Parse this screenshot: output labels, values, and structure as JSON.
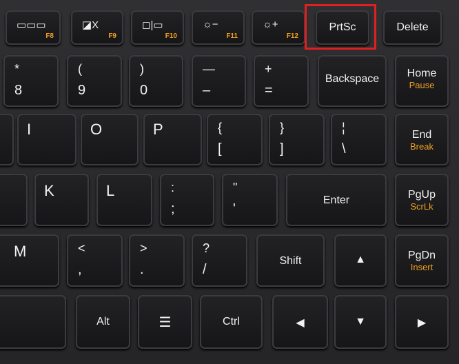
{
  "highlight": {
    "target": "PrtSc",
    "color": "#e02020"
  },
  "function_row": [
    {
      "icon": "display-mode-icon",
      "glyph": "▭▭▭",
      "fn": "F8"
    },
    {
      "icon": "touchpad-off-icon",
      "glyph": "◪X",
      "fn": "F9"
    },
    {
      "icon": "projector-icon",
      "glyph": "◻|▭",
      "fn": "F10"
    },
    {
      "icon": "brightness-down-icon",
      "glyph": "☼−",
      "fn": "F11"
    },
    {
      "icon": "brightness-up-icon",
      "glyph": "☼+",
      "fn": "F12"
    },
    {
      "label": "PrtSc"
    },
    {
      "label": "Delete"
    }
  ],
  "number_row": [
    {
      "top": "*",
      "bottom": "8"
    },
    {
      "top": "(",
      "bottom": "9"
    },
    {
      "top": ")",
      "bottom": "0"
    },
    {
      "top": "—",
      "bottom": "–"
    },
    {
      "top": "+",
      "bottom": "="
    },
    {
      "label": "Backspace"
    },
    {
      "label": "Home",
      "sub": "Pause"
    }
  ],
  "top_row": [
    {
      "label": "I"
    },
    {
      "label": "O"
    },
    {
      "label": "P"
    },
    {
      "top": "{",
      "bottom": "["
    },
    {
      "top": "}",
      "bottom": "]"
    },
    {
      "top": "¦",
      "bottom": "\\"
    },
    {
      "label": "End",
      "sub": "Break"
    }
  ],
  "home_row": [
    {
      "label": "K"
    },
    {
      "label": "L"
    },
    {
      "top": ":",
      "bottom": ";"
    },
    {
      "top": "\"",
      "bottom": "'"
    },
    {
      "label": "Enter"
    },
    {
      "label": "PgUp",
      "sub": "ScrLk"
    }
  ],
  "bottom_row": [
    {
      "label": "M"
    },
    {
      "top": "<",
      "bottom": ","
    },
    {
      "top": ">",
      "bottom": "."
    },
    {
      "top": "?",
      "bottom": "/"
    },
    {
      "label": "Shift"
    },
    {
      "glyph": "▲"
    },
    {
      "label": "PgDn",
      "sub": "Insert"
    }
  ],
  "space_row": [
    {
      "label": "Alt"
    },
    {
      "glyph": "☰",
      "icon": "menu-icon"
    },
    {
      "label": "Ctrl"
    },
    {
      "glyph": "◀"
    },
    {
      "glyph": "▼"
    },
    {
      "glyph": "▶"
    }
  ]
}
